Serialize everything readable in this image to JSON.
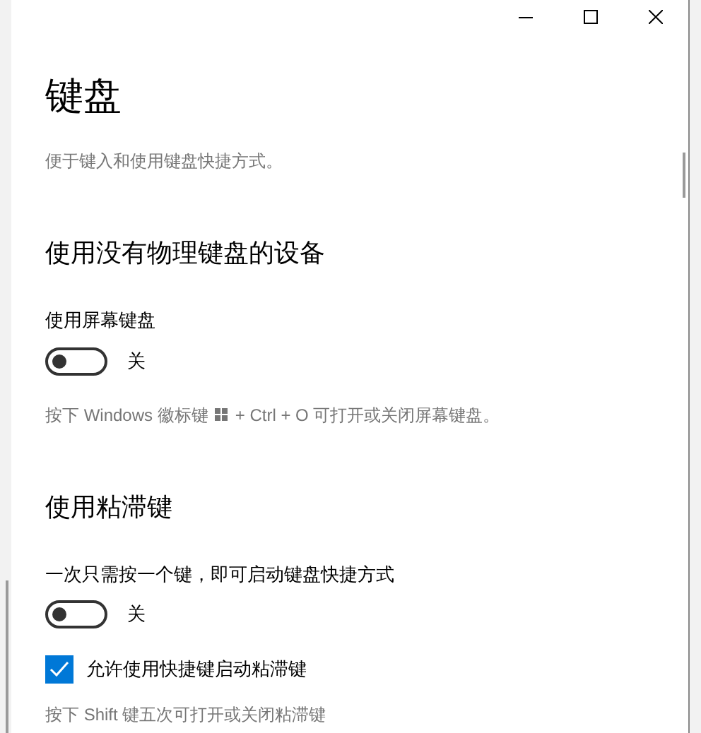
{
  "page": {
    "title": "键盘",
    "subtitle": "便于键入和使用键盘快捷方式。"
  },
  "sections": [
    {
      "heading": "使用没有物理键盘的设备",
      "items": [
        {
          "kind": "label",
          "text": "使用屏幕键盘"
        },
        {
          "kind": "toggle",
          "on": false,
          "state_text": "关"
        },
        {
          "kind": "hint_keys",
          "before": "按下 Windows 徽标键",
          "after": "+ Ctrl + O 可打开或关闭屏幕键盘。"
        }
      ]
    },
    {
      "heading": "使用粘滞键",
      "items": [
        {
          "kind": "label",
          "text": "一次只需按一个键，即可启动键盘快捷方式"
        },
        {
          "kind": "toggle",
          "on": false,
          "state_text": "关"
        },
        {
          "kind": "checkbox",
          "checked": true,
          "text": "允许使用快捷键启动粘滞键"
        },
        {
          "kind": "hint",
          "text": "按下 Shift 键五次可打开或关闭粘滞键"
        }
      ]
    }
  ]
}
